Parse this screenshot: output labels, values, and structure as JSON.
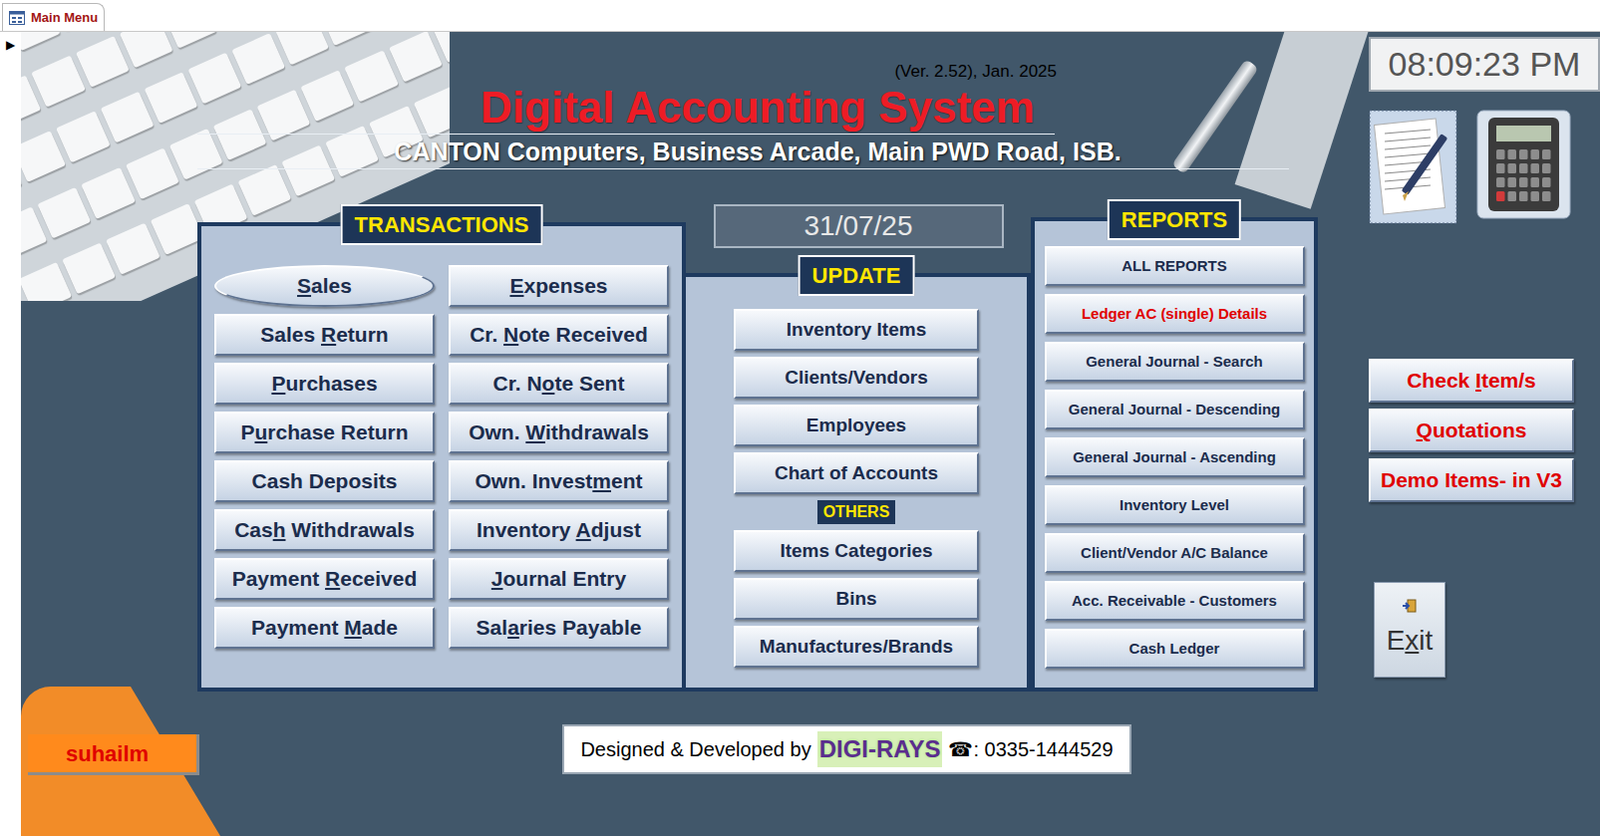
{
  "window": {
    "tab": "Main Menu"
  },
  "record_selector": "▶",
  "header": {
    "version": "(Ver. 2.52), Jan. 2025",
    "title": "Digital Accounting System",
    "subtitle": "CANTON Computers, Business Arcade, Main PWD Road, ISB."
  },
  "clock": "08:09:23 PM",
  "date": "31/07/25",
  "transactions": {
    "title": "TRANSACTIONS",
    "columns": [
      [
        {
          "label": "Sales",
          "hotkey": 0,
          "selected": true
        },
        {
          "label": "Sales Return",
          "hotkey": 6,
          "selected": false
        },
        {
          "label": "Purchases",
          "hotkey": 0,
          "selected": false
        },
        {
          "label": "Purchase Return",
          "hotkey": 1,
          "selected": false
        },
        {
          "label": "Cash Deposits",
          "hotkey": -1,
          "selected": false
        },
        {
          "label": "Cash Withdrawals",
          "hotkey": 3,
          "selected": false
        },
        {
          "label": "Payment Received",
          "hotkey": 8,
          "selected": false
        },
        {
          "label": "Payment Made",
          "hotkey": 8,
          "selected": false
        }
      ],
      [
        {
          "label": "Expenses",
          "hotkey": 0,
          "selected": false
        },
        {
          "label": "Cr. Note Received",
          "hotkey": 4,
          "selected": false
        },
        {
          "label": "Cr. Note Sent",
          "hotkey": 5,
          "selected": false
        },
        {
          "label": "Own. Withdrawals",
          "hotkey": 5,
          "selected": false
        },
        {
          "label": "Own. Investment",
          "hotkey": 11,
          "selected": false
        },
        {
          "label": "Inventory Adjust",
          "hotkey": 10,
          "selected": false
        },
        {
          "label": "Journal Entry",
          "hotkey": 0,
          "selected": false
        },
        {
          "label": "Salaries Payable",
          "hotkey": 3,
          "selected": false
        }
      ]
    ]
  },
  "update": {
    "title": "UPDATE",
    "buttons": [
      "Inventory Items",
      "Clients/Vendors",
      "Employees",
      "Chart of Accounts"
    ],
    "others_title": "OTHERS",
    "others": [
      "Items Categories",
      "Bins",
      "Manufactures/Brands"
    ]
  },
  "reports": {
    "title": "REPORTS",
    "buttons": [
      {
        "label": "ALL REPORTS",
        "color": "#1b2c4c"
      },
      {
        "label": "Ledger AC (single) Details",
        "color": "#e00000"
      },
      {
        "label": "General Journal - Search",
        "color": "#1b2c4c"
      },
      {
        "label": "General Journal - Descending",
        "color": "#1b2c4c"
      },
      {
        "label": "General Journal - Ascending",
        "color": "#1b2c4c"
      },
      {
        "label": "Inventory Level",
        "color": "#1b2c4c"
      },
      {
        "label": "Client/Vendor A/C Balance",
        "color": "#1b2c4c"
      },
      {
        "label": "Acc. Receivable - Customers",
        "color": "#1b2c4c"
      },
      {
        "label": "Cash Ledger",
        "color": "#1b2c4c"
      }
    ]
  },
  "side_buttons": [
    {
      "label": "Check Item/s",
      "hotkey": 6
    },
    {
      "label": "Quotations",
      "hotkey": 0
    },
    {
      "label": "Demo Items- in V3",
      "hotkey": -1
    }
  ],
  "exit": {
    "label": "Exit",
    "hotkey": 1
  },
  "user": "suhailm",
  "footer": {
    "prefix": "Designed & Developed by",
    "brand": "DIGI-RAYS",
    "phone": "☎: 0335-1444529"
  }
}
